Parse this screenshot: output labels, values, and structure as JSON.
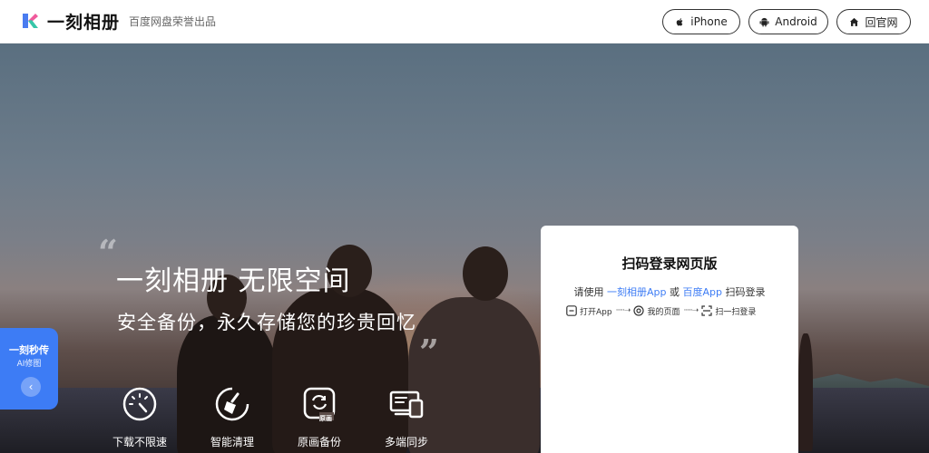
{
  "header": {
    "brand": "一刻相册",
    "tagline": "百度网盘荣誉出品",
    "buttons": [
      {
        "label": "iPhone",
        "icon": "apple-icon"
      },
      {
        "label": "Android",
        "icon": "android-icon"
      },
      {
        "label": "回官网",
        "icon": "home-icon"
      }
    ]
  },
  "hero": {
    "title": "一刻相册 无限空间",
    "subtitle": "安全备份，永久存储您的珍贵回忆",
    "features": [
      {
        "label": "下载不限速",
        "icon": "speedometer-icon"
      },
      {
        "label": "智能清理",
        "icon": "broom-icon"
      },
      {
        "label": "原画备份",
        "icon": "backup-icon",
        "badge": "原画"
      },
      {
        "label": "多端同步",
        "icon": "devices-icon"
      }
    ]
  },
  "side_tab": {
    "title": "一刻秒传",
    "subtitle": "AI修图"
  },
  "login": {
    "title": "扫码登录网页版",
    "instruction_prefix": "请使用",
    "app1": "一刻相册App",
    "instruction_or": "或",
    "app2": "百度App",
    "instruction_suffix": "扫码登录",
    "steps": [
      "打开App",
      "我的页面",
      "扫一扫登录"
    ]
  },
  "colors": {
    "accent": "#3d7cf5",
    "header_bg": "#ffffff",
    "card_bg": "#ffffff"
  }
}
